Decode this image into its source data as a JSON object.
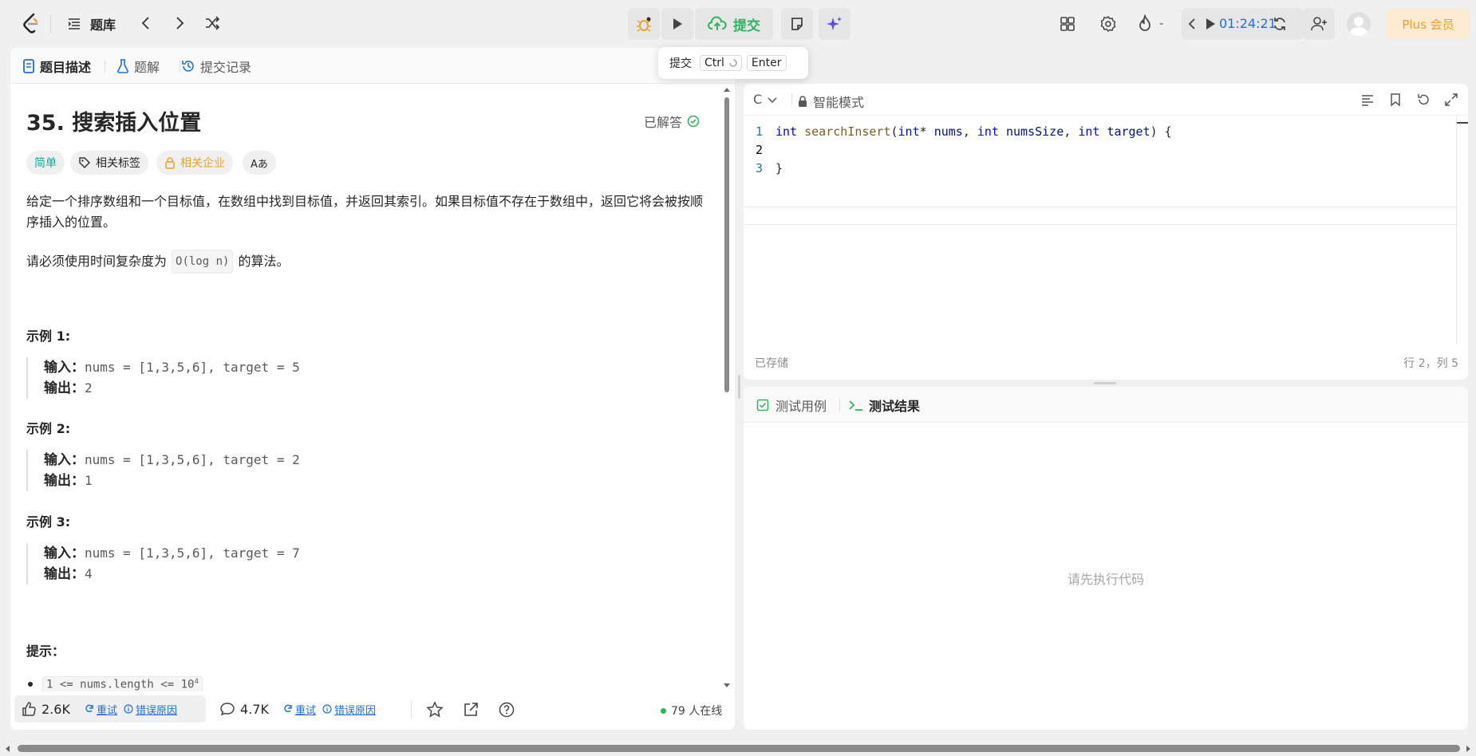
{
  "header": {
    "problem_list_label": "题库",
    "submit_label": "提交",
    "timer": "01:24:21",
    "streak": "-",
    "plus_label": "Plus 会员"
  },
  "tooltip": {
    "label": "提交",
    "key1": "Ctrl",
    "key2": "Enter"
  },
  "left_tabs": [
    {
      "label": "题目描述"
    },
    {
      "label": "题解"
    },
    {
      "label": "提交记录"
    }
  ],
  "problem": {
    "title": "35. 搜索插入位置",
    "status": "已解答",
    "difficulty": "简单",
    "tags_label": "相关标签",
    "company_label": "相关企业",
    "translate_label": "Aあ",
    "description_1": "给定一个排序数组和一个目标值，在数组中找到目标值，并返回其索引。如果目标值不存在于数组中，返回它将会被按顺序插入的位置。",
    "description_2_pre": "请必须使用时间复杂度为",
    "description_2_code": "O(log n)",
    "description_2_post": "的算法。",
    "examples": [
      {
        "title": "示例 1:",
        "input_label": "输入：",
        "input": "nums = [1,3,5,6], target = 5",
        "output_label": "输出：",
        "output": "2"
      },
      {
        "title": "示例 2:",
        "input_label": "输入：",
        "input": "nums = [1,3,5,6], target = 2",
        "output_label": "输出：",
        "output": "1"
      },
      {
        "title": "示例 3:",
        "input_label": "输入：",
        "input": "nums = [1,3,5,6], target = 7",
        "output_label": "输出：",
        "output": "4"
      }
    ],
    "hints_title": "提示：",
    "constraint_1": "1 <= nums.length <= 10",
    "constraint_1_sup": "4"
  },
  "bottom_bar": {
    "likes": "2.6K",
    "retry_1": "重试",
    "error_1": "错误原因",
    "comments": "4.7K",
    "retry_2": "重试",
    "error_2": "错误原因",
    "online": "79 人在线"
  },
  "editor": {
    "language": "C",
    "mode": "智能模式",
    "saved": "已存储",
    "cursor_pos": "行 2，列 5",
    "lines": [
      {
        "num": "1",
        "kw1": "int",
        "fn": "searchInsert",
        "p1": "(",
        "kw2": "int",
        "p2": "* ",
        "v1": "nums",
        "p3": ", ",
        "kw3": "int",
        "p4": " ",
        "v2": "numsSize",
        "p5": ", ",
        "kw4": "int",
        "p6": " ",
        "v3": "target",
        "p7": ") {"
      },
      {
        "num": "2"
      },
      {
        "num": "3",
        "text": "}"
      }
    ]
  },
  "test": {
    "tab_cases": "测试用例",
    "tab_results": "测试结果",
    "placeholder": "请先执行代码"
  },
  "colors": {
    "accent_green": "#2db55d",
    "plus_bg": "#fdecd3",
    "plus_fg": "#f0a020",
    "difficulty": "#00af9b"
  }
}
